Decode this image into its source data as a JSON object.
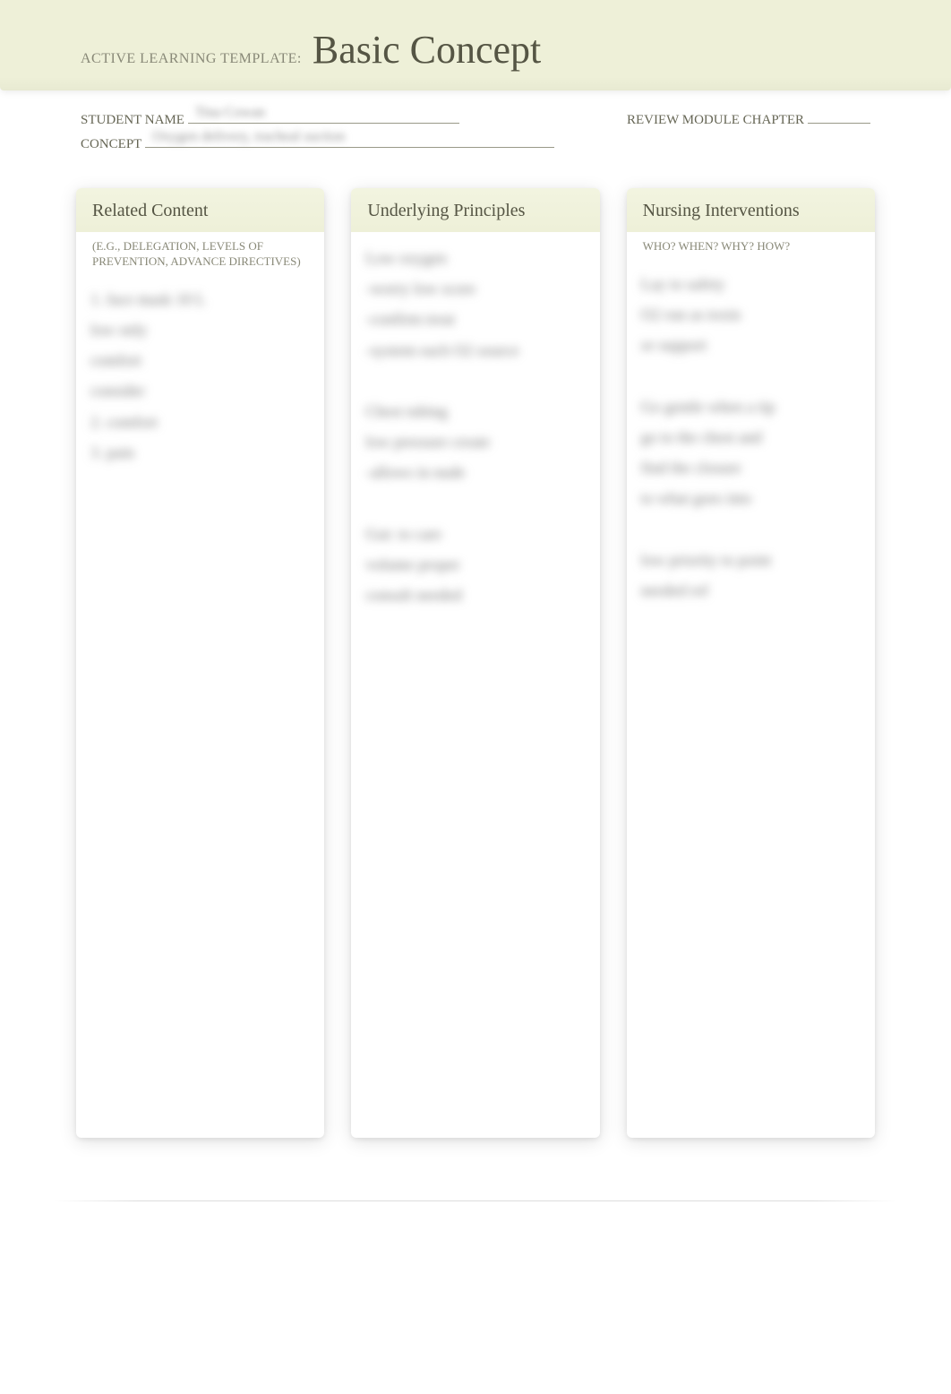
{
  "header": {
    "template_label": "ACTIVE LEARNING TEMPLATE:",
    "title": "Basic Concept"
  },
  "meta": {
    "student_name_label": "STUDENT NAME",
    "student_name_value": "Tina Cowan",
    "concept_label": "CONCEPT",
    "concept_value": "Oxygen delivery, tracheal suction",
    "chapter_label": "REVIEW MODULE CHAPTER",
    "chapter_value": ""
  },
  "columns": {
    "related": {
      "title": "Related Content",
      "subtitle": "(E.G., DELEGATION, LEVELS OF PREVENTION, ADVANCE DIRECTIVES)",
      "body": "1. face mask 10 L\n   low only\n   comfort\n   consider\n2.  comfort\n3. pain"
    },
    "principles": {
      "title": "Underlying Principles",
      "body": "Low oxygen\n  -worry low score\n  -confirm treat\n  -system each O2 source\n\nChest tubing\n  low pressure create\n  -allows in nude\n\nGut: to care\n  volume proper\n  consult needed"
    },
    "interventions": {
      "title": "Nursing Interventions",
      "subtitle": "WHO? WHEN? WHY? HOW?",
      "body": "Lay  to  safety\n  O2  run  as toxin\n  or  support\n\nGo gentle when a tip\ngo to the chest and\nfind the closure\nto what goes into\n\nlow priority to point\nneeded ref"
    }
  }
}
